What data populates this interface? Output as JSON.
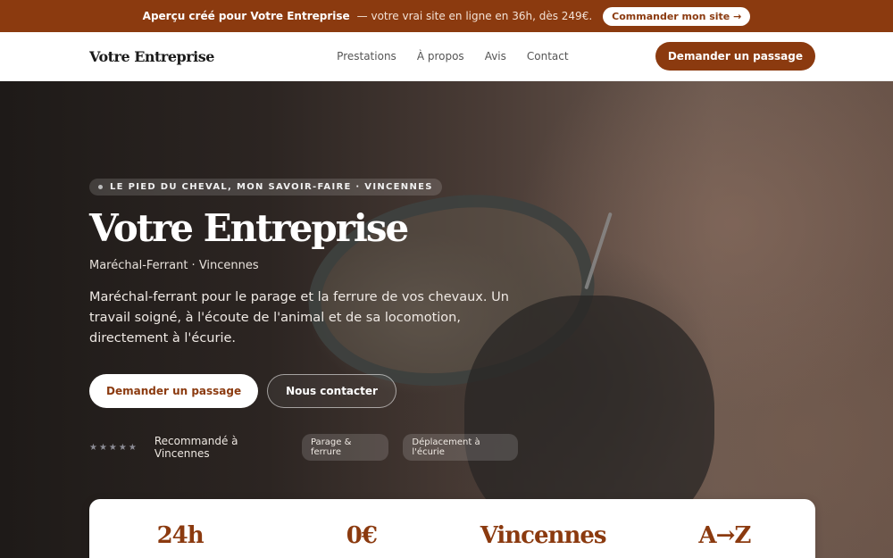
{
  "topbar": {
    "preview_strong": "Aperçu créé pour Votre Entreprise",
    "preview_rest": "— votre vrai site en ligne en 36h, dès 249€.",
    "order_button": "Commander mon site →"
  },
  "nav": {
    "brand": "Votre Entreprise",
    "links": [
      "Prestations",
      "À propos",
      "Avis",
      "Contact"
    ],
    "cta": "Demander un passage"
  },
  "hero": {
    "kicker": "LE PIED DU CHEVAL, MON SAVOIR-FAIRE · VINCENNES",
    "title": "Votre Entreprise",
    "subtitle": "Maréchal-Ferrant · Vincennes",
    "description": "Maréchal-ferrant pour le parage et la ferrure de vos chevaux. Un travail soigné, à l'écoute de l'animal et de sa locomotion, directement à l'écurie.",
    "primary_button": "Demander un passage",
    "secondary_button": "Nous contacter",
    "stars": "★★★★★",
    "recommendation": "Recommandé à Vincennes",
    "chips": [
      "Parage & ferrure",
      "Déplacement à l'écurie"
    ]
  },
  "stats": [
    "24h",
    "0€",
    "Vincennes",
    "A→Z"
  ],
  "colors": {
    "accent": "#8b3a0f",
    "topbar_bg": "#8b3a0f",
    "hero_overlay": "#2c2522"
  },
  "icons": {
    "kicker_dot": "dot-icon",
    "rating": "star-icon"
  }
}
